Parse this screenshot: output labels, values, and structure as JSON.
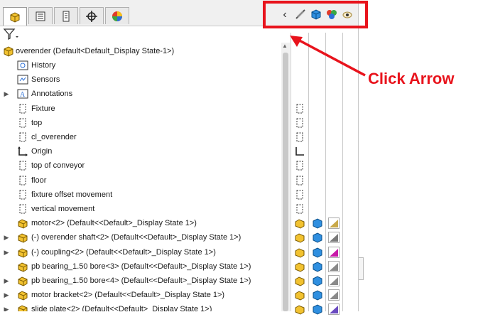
{
  "tabs": [
    {
      "name": "featuremanager-tab-icon"
    },
    {
      "name": "propertymanager-tab-icon"
    },
    {
      "name": "configurationmanager-tab-icon"
    },
    {
      "name": "dimxpertmanager-tab-icon"
    },
    {
      "name": "displaymanager-tab-icon"
    }
  ],
  "display_pane": {
    "collapse_arrow": "‹"
  },
  "annotation": {
    "label": "Click Arrow",
    "color": "#e8131c"
  },
  "tree": {
    "root": "overender  (Default<Default_Display State-1>)",
    "items": [
      {
        "label": "History",
        "icon": "history-icon"
      },
      {
        "label": "Sensors",
        "icon": "sensors-icon"
      },
      {
        "label": "Annotations",
        "icon": "annotations-icon"
      },
      {
        "label": "Fixture",
        "icon": "plane-icon"
      },
      {
        "label": "top",
        "icon": "plane-icon"
      },
      {
        "label": "cl_overender",
        "icon": "plane-icon"
      },
      {
        "label": "Origin",
        "icon": "origin-icon"
      },
      {
        "label": "top of conveyor",
        "icon": "plane-icon"
      },
      {
        "label": "floor",
        "icon": "plane-icon"
      },
      {
        "label": "fixture offset movement",
        "icon": "plane-icon"
      },
      {
        "label": "vertical movement",
        "icon": "plane-icon"
      },
      {
        "label": "motor<2> (Default<<Default>_Display State 1>)",
        "icon": "part-icon"
      },
      {
        "label": "(-) overender shaft<2> (Default<<Default>_Display State 1>)",
        "icon": "part-icon"
      },
      {
        "label": "(-) coupling<2> (Default<<Default>_Display State 1>)",
        "icon": "part-icon"
      },
      {
        "label": "pb bearing_1.50 bore<3> (Default<<Default>_Display State 1>)",
        "icon": "part-icon"
      },
      {
        "label": "pb bearing_1.50 bore<4> (Default<<Default>_Display State 1>)",
        "icon": "part-icon"
      },
      {
        "label": "motor bracket<2> (Default<<Default>_Display State 1>)",
        "icon": "part-icon"
      },
      {
        "label": "slide plate<2> (Default<<Default>_Display State 1>)",
        "icon": "part-icon"
      }
    ]
  },
  "colors": {
    "accent": "#e8131c",
    "appearance_colors": [
      "#c9a94a",
      "#7a7a7a",
      "#c81aa8",
      "#8a8a8a",
      "#8a8a8a",
      "#8a8a8a",
      "#6a4ac0"
    ]
  }
}
